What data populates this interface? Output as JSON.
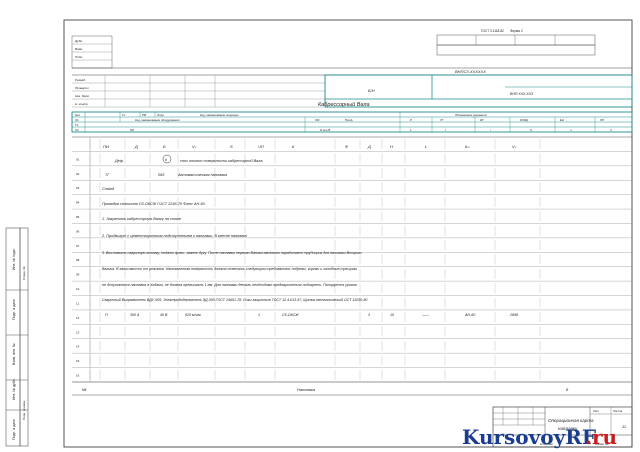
{
  "header": {
    "gost_form": "ГОСТ 3.1118-82",
    "form_label": "Форма 2",
    "doc_code": "ВНПСЗ.ХХХХХХ",
    "sheet_code": "ВНП.ХХХ.ХХХ",
    "part_code": "Б/Н",
    "part_name": "Кабрессорный Вала",
    "left_labels": [
      "Дубл.",
      "Взам.",
      "Подл.",
      "Разраб.",
      "Проверил",
      "Нач. бюро",
      "Н. контр."
    ]
  },
  "table": {
    "header_cols": [
      "Цех",
      "Уч.",
      "РМ",
      "Опер.",
      "Код, наименование операции",
      "Обозначение документа"
    ],
    "sub_cols": [
      "Код, наименование оборудования",
      "СМ",
      "Проф.",
      "Р",
      "УТ",
      "КР",
      "КОИД",
      "ЕН",
      "ОП",
      "Кшт",
      "Тпз",
      "Тшт"
    ],
    "param_cols": [
      "ПИ",
      "D или В",
      "L",
      "t",
      "i",
      "S",
      "n",
      "V"
    ],
    "row_markers": [
      "О1",
      "Т2",
      "О3",
      "О4",
      "О5",
      "Т6",
      "Р7"
    ],
    "col_headers_row": [
      "ПИ",
      "Д",
      "Б",
      "Vₙ",
      "S",
      "ЧП",
      "К",
      "Ф",
      "Д",
      "Н",
      "L",
      "Кₘ",
      "Vₙ"
    ],
    "rows": [
      {
        "num": "01",
        "text": "Деф",
        "circle": "6",
        "desc": "снос отклон поверхности кабрессорной Вала"
      },
      {
        "num": "02",
        "text": "ТГ",
        "extra": "065",
        "desc": "Автоматическая наплавка"
      },
      {
        "num": "03",
        "text": "Станд"
      },
      {
        "num": "04",
        "text": "Проводка сплошная С5-ОКСЖ ГОСТ 2246-70 Флюс АН-60"
      },
      {
        "num": "05",
        "text": "1. Закрепить кабрессорную Валку на стоке"
      },
      {
        "num": "06",
        "text": "2. Продвигут с цементационным подступлением к наплавки. В месте наплавки"
      },
      {
        "num": "07",
        "text": "3. Выставить сварочную головку, подать флюс, зажечь дугу. После наплавки первого Валика автомат наработает трубопрок для наплавки Второго"
      },
      {
        "num": "08",
        "text": "Валика. В зависимости от режимов. Наплавленная поверхность должна отвечать следующим требованиям: подрезы, корнки и холодные трещины"
      },
      {
        "num": "09",
        "text": "не допускаются наплавка в Ходами, не должна превышать 1 мм. Для наплавки деталь необходимо предварительно подогреть. Полируется уровня"
      },
      {
        "num": "10",
        "text": "Сварочный Выпрямитель ВДУ-505, Электрододержатель ЭД-300 ГОСТ 14651-78, Очки защитные ГОСТ 12.4.013-97, Щиток металлический ОСТ 11030-80"
      },
      {
        "num": "11",
        "cells": [
          "П",
          "300 А",
          "40 В",
          "625 м/час",
          "1",
          "С5-ОКСЖ",
          "3",
          "10",
          "——",
          "АН-60",
          "2898"
        ]
      },
      {
        "num": "12"
      },
      {
        "num": "13"
      },
      {
        "num": "14"
      },
      {
        "num": "15"
      },
      {
        "num": "16"
      }
    ],
    "footer_label": "Наплавка",
    "footer_mark": "МК",
    "footer_num": "8"
  },
  "stamp": {
    "title_line1": "Операционная карта",
    "title_line2": "наплавки",
    "sheet_label": "Лист",
    "sheet_value": "11",
    "sheets_label": "Листов",
    "copied": "Копировал",
    "format": "Формат А4"
  },
  "watermark": {
    "part_a": "KursovoyRF",
    "part_b": ".ru"
  },
  "side": {
    "labels": [
      "Инв. № подл.",
      "Подп. и дата",
      "Взам. инв. №",
      "Инв. № дубл.",
      "Подп. и дата",
      "Справ. №",
      "Перв. примен."
    ]
  }
}
